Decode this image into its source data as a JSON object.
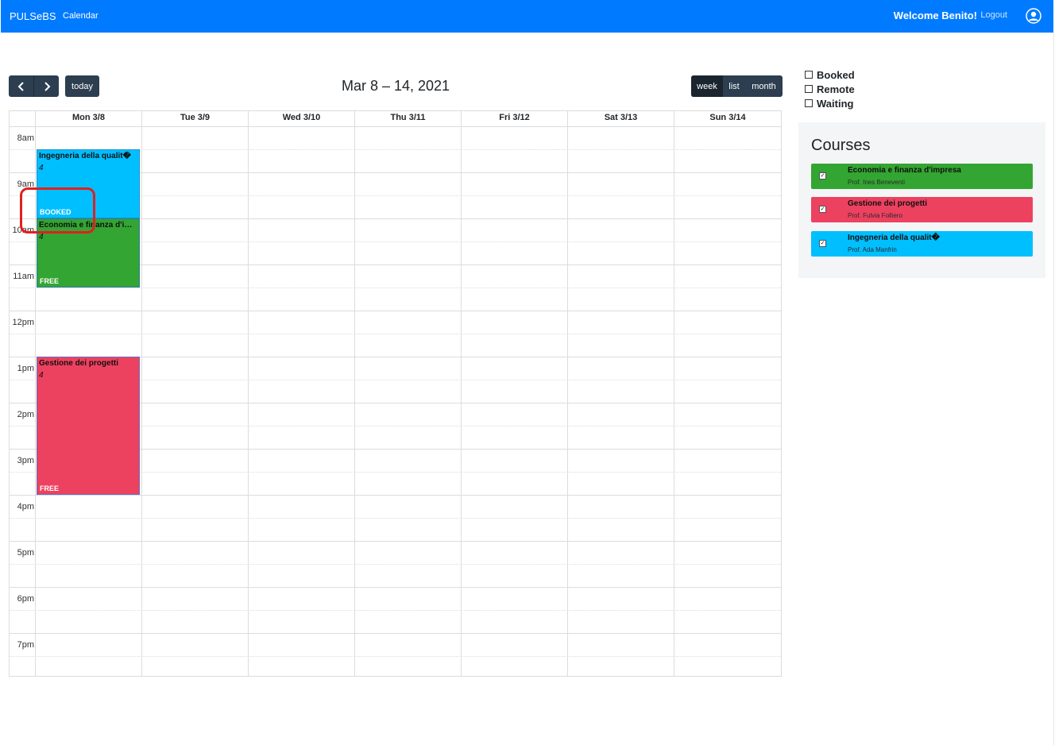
{
  "navbar": {
    "brand": "PULSeBS",
    "link": "Calendar",
    "welcome": "Welcome Benito!",
    "logout": "Logout",
    "bg_color": "#007bff"
  },
  "toolbar": {
    "today": "today",
    "title": "Mar 8 – 14, 2021",
    "views": [
      "week",
      "list",
      "month"
    ],
    "active_view": "week"
  },
  "calendar": {
    "days": [
      "Mon 3/8",
      "Tue 3/9",
      "Wed 3/10",
      "Thu 3/11",
      "Fri 3/12",
      "Sat 3/13",
      "Sun 3/14"
    ],
    "times": [
      "8am",
      "9am",
      "10am",
      "11am",
      "12pm",
      "1pm",
      "2pm",
      "3pm",
      "4pm",
      "5pm",
      "6pm",
      "7pm"
    ],
    "events": [
      {
        "title": "Ingegneria della qualit�",
        "sub": "4",
        "status": "BOOKED",
        "color": "#00bfff",
        "start": "08:30",
        "end": "10:00",
        "day": "Mon 3/8"
      },
      {
        "title": "Economia e finanza d'impresa",
        "sub": "4",
        "status": "FREE",
        "color": "#33a532",
        "start": "10:00",
        "end": "11:30",
        "day": "Mon 3/8"
      },
      {
        "title": "Gestione dei progetti",
        "sub": "4",
        "status": "FREE",
        "color": "#ed4160",
        "start": "13:00",
        "end": "16:00",
        "day": "Mon 3/8"
      }
    ]
  },
  "legend": [
    "Booked",
    "Remote",
    "Waiting"
  ],
  "courses": {
    "title": "Courses",
    "items": [
      {
        "name": "Economia e finanza d'impresa",
        "prof": "Prof. Ines Beneventi",
        "color": "#33a532"
      },
      {
        "name": "Gestione dei progetti",
        "prof": "Prof. Fulvia Folliero",
        "color": "#ed4160"
      },
      {
        "name": "Ingegneria della qualit�",
        "prof": "Prof. Ada Manfrin",
        "color": "#00bfff"
      }
    ]
  }
}
